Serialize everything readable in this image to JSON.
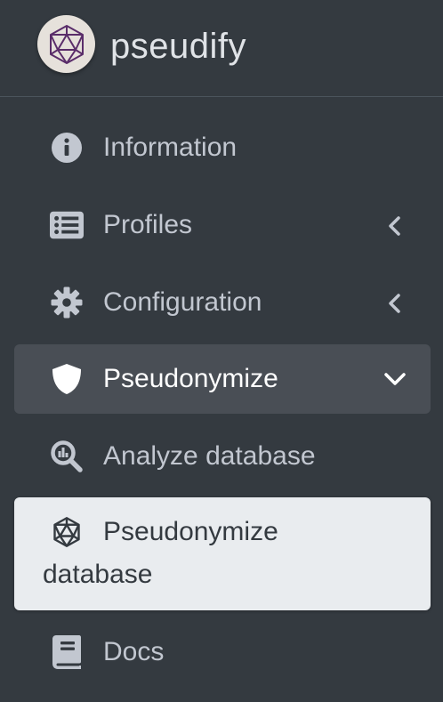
{
  "brand": {
    "name": "pseudify",
    "logo_icon": "icosahedron-logo"
  },
  "colors": {
    "sidebar_bg": "#343a40",
    "text": "#c2c7d0",
    "open_bg": "#494e55",
    "active_bg": "#e9ecef",
    "active_text": "#343a40",
    "logo_stroke": "#5a2d6a"
  },
  "nav": {
    "information": {
      "label": "Information",
      "icon": "info-circle-icon"
    },
    "profiles": {
      "label": "Profiles",
      "icon": "list-alt-icon",
      "arrow": "chevron-left-icon"
    },
    "configuration": {
      "label": "Configuration",
      "icon": "gear-icon",
      "arrow": "chevron-left-icon"
    },
    "pseudonymize": {
      "label": "Pseudonymize",
      "icon": "shield-icon",
      "arrow": "chevron-down-icon"
    },
    "analyze_database": {
      "label": "Analyze database",
      "icon": "search-chart-icon"
    },
    "pseudonymize_database": {
      "label_line1": "Pseudonymize",
      "label_line2": "database",
      "icon": "icosahedron-icon"
    },
    "docs": {
      "label": "Docs",
      "icon": "book-icon"
    }
  }
}
